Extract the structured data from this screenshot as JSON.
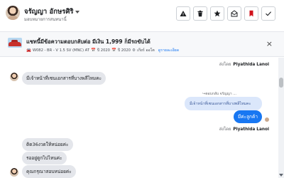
{
  "header": {
    "name": "จรัญญา อักษรศิริ",
    "role": "มอบหมายการสนทนานี้"
  },
  "toolbar": {
    "buttons": [
      {
        "name": "report-button",
        "icon": "warning-triangle-icon"
      },
      {
        "name": "delete-button",
        "icon": "trash-icon"
      },
      {
        "name": "star-button",
        "icon": "star-icon"
      },
      {
        "name": "mark-unread-button",
        "icon": "envelope-open-icon"
      },
      {
        "name": "tag-button",
        "icon": "bookmark-tag-icon"
      },
      {
        "name": "done-button",
        "icon": "checkmark-icon"
      }
    ],
    "tag_color": "#d0121b"
  },
  "banner": {
    "title": "แชทนี้มีข้อความตอบกลับต่อ มีเงิน 1,999 ก็มีรถขับได้",
    "model": "W082 - BR - V 1.5 SV (MNC) AT",
    "year": "ปี 2020",
    "reg_year": "ปี 2020",
    "location": "เกียร์ ออโต",
    "details_link": "ดูรายละเอียด",
    "close_symbol": "×"
  },
  "chat": {
    "sent_by_prefix": "ส่งโดย",
    "agent_name": "Piyathida Lanoi",
    "messages": {
      "m1": "มีเจ้าหน้าที่เซนเอกสารที่บางพลีไหมคะ",
      "reply_label": "↪ตอบกลับ จรัญญา ...",
      "reply_quote": "มีเจ้าหน้าที่เซนเอกสารที่บางพลีไหมคะ",
      "m2": "มีค่ะลูกค้า",
      "m3": "ติด36งวดให้หน่อยค่ะ",
      "m4": "รออยู่ดูกไปไหนค่ะ",
      "m5": "คุณกรุณาสอบหน่อยค่ะ"
    }
  },
  "colors": {
    "accent": "#1877f2",
    "incoming_bubble": "#e4e6eb",
    "reply_quote_bg": "#dbe7fb"
  }
}
